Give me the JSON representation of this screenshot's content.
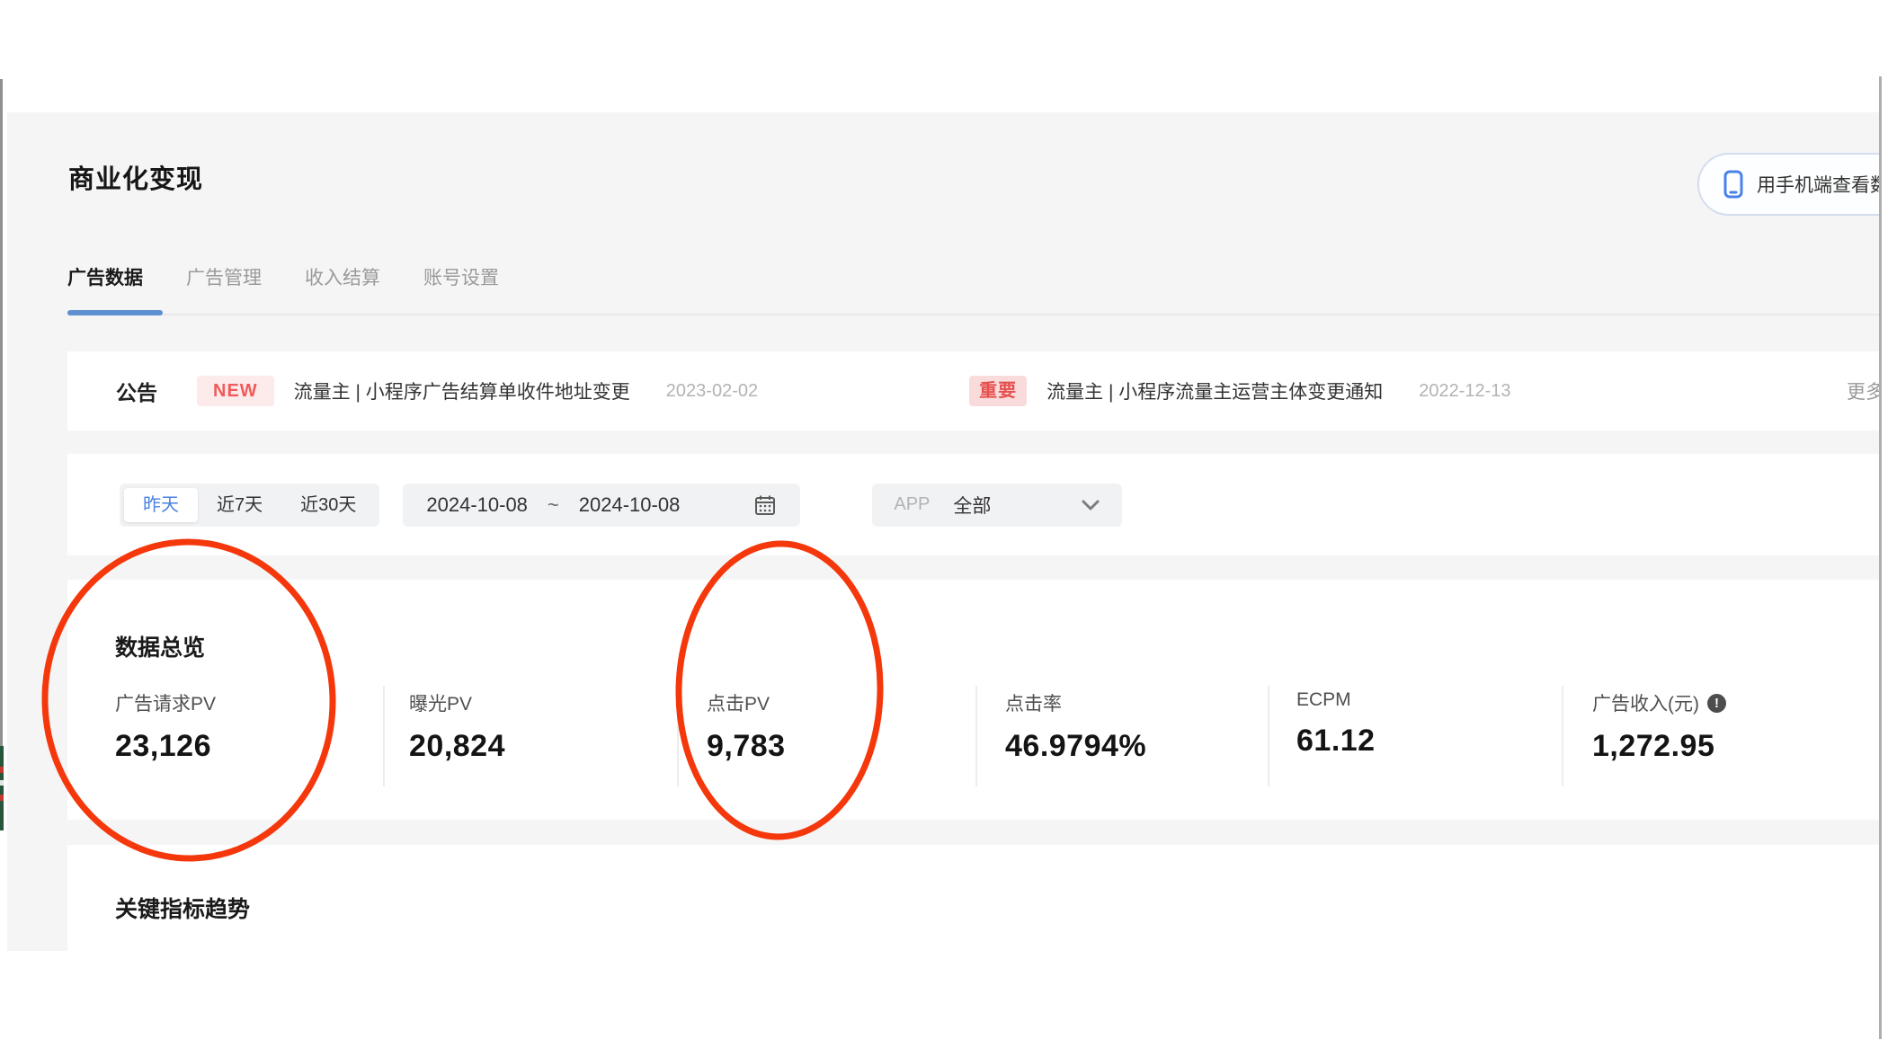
{
  "header": {
    "title": "商业化变现",
    "phone_button_label": "用手机端查看数据"
  },
  "tabs": [
    {
      "label": "广告数据",
      "active": true
    },
    {
      "label": "广告管理",
      "active": false
    },
    {
      "label": "收入结算",
      "active": false
    },
    {
      "label": "账号设置",
      "active": false
    }
  ],
  "announcement": {
    "label": "公告",
    "items": [
      {
        "badge": "NEW",
        "text": "流量主 | 小程序广告结算单收件地址变更",
        "date": "2023-02-02"
      },
      {
        "badge": "重要",
        "text": "流量主 | 小程序流量主运营主体变更通知",
        "date": "2022-12-13"
      }
    ],
    "more_label": "更多"
  },
  "filters": {
    "quick_ranges": [
      {
        "label": "昨天",
        "active": true
      },
      {
        "label": "近7天",
        "active": false
      },
      {
        "label": "近30天",
        "active": false
      }
    ],
    "date_start": "2024-10-08",
    "date_separator": "~",
    "date_end": "2024-10-08",
    "app_label": "APP",
    "app_value": "全部"
  },
  "overview": {
    "title": "数据总览",
    "metrics": [
      {
        "label": "广告请求PV",
        "value": "23,126"
      },
      {
        "label": "曝光PV",
        "value": "20,824"
      },
      {
        "label": "点击PV",
        "value": "9,783"
      },
      {
        "label": "点击率",
        "value": "46.9794%"
      },
      {
        "label": "ECPM",
        "value": "61.12"
      },
      {
        "label": "广告收入(元)",
        "value": "1,272.95"
      }
    ],
    "info_icon_glyph": "!"
  },
  "trend": {
    "title": "关键指标趋势"
  },
  "colors": {
    "page_bg": "#f5f5f6",
    "card_bg": "#ffffff",
    "accent_blue": "#4a80e0",
    "tab_underline_blue": "#5e8fd0",
    "badge_red_text": "#f05a5a",
    "badge_red_bg": "#fdeaea",
    "annotation_red": "#f5380c"
  }
}
